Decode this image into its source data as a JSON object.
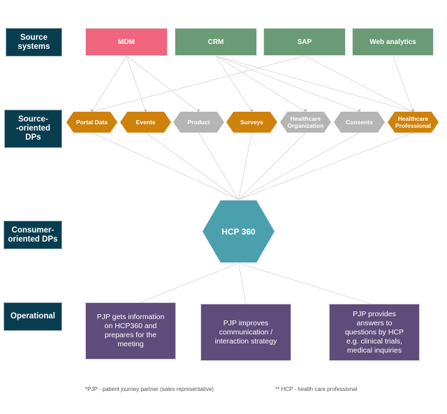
{
  "lanes": {
    "source_systems": "Source\nsystems",
    "source_dps": "Source-\n-oriented\nDPs",
    "consumer_dps": "Consumer-\noriented DPs",
    "operational": "Operational"
  },
  "source_systems": [
    {
      "id": "mdm",
      "label": "MDM",
      "color": "#F0647D"
    },
    {
      "id": "crm",
      "label": "CRM",
      "color": "#6B9B76"
    },
    {
      "id": "sap",
      "label": "SAP",
      "color": "#6B9B76"
    },
    {
      "id": "web",
      "label": "Web analytics",
      "color": "#6B9B76"
    }
  ],
  "source_dps": [
    {
      "id": "portal",
      "label": "Portal Data",
      "style": "orange"
    },
    {
      "id": "events",
      "label": "Events",
      "style": "orange"
    },
    {
      "id": "product",
      "label": "Product",
      "style": "gray"
    },
    {
      "id": "surveys",
      "label": "Surveys",
      "style": "orange"
    },
    {
      "id": "hco",
      "label": "Healthcare\nOrganization",
      "style": "gray"
    },
    {
      "id": "consents",
      "label": "Consents",
      "style": "gray"
    },
    {
      "id": "hcp",
      "label": "Healthcare\nProfessional",
      "style": "orange"
    }
  ],
  "consumer_dp": {
    "label": "HCP 360",
    "color": "#4AA1AD"
  },
  "operational": [
    {
      "label": "PJP gets information\non HCP360 and\nprepares for the\nmeeting"
    },
    {
      "label": "PJP improves\ncommunication /\ninteraction strategy"
    },
    {
      "label": "PJP provides\nanswers to\nquestions by HCP\ne.g. clinical trials,\nmedical inquiries"
    }
  ],
  "links": {
    "source_to_dp": [
      [
        "mdm",
        "portal"
      ],
      [
        "mdm",
        "events"
      ],
      [
        "mdm",
        "product"
      ],
      [
        "crm",
        "surveys"
      ],
      [
        "crm",
        "hco"
      ],
      [
        "crm",
        "consents"
      ],
      [
        "crm",
        "hcp"
      ],
      [
        "sap",
        "portal"
      ],
      [
        "sap",
        "hcp"
      ],
      [
        "web",
        "hcp"
      ]
    ]
  },
  "footnotes": {
    "pjp": "*PJP - patient journey partner (sales representative)",
    "hcp": "** HCP - health care professional"
  }
}
